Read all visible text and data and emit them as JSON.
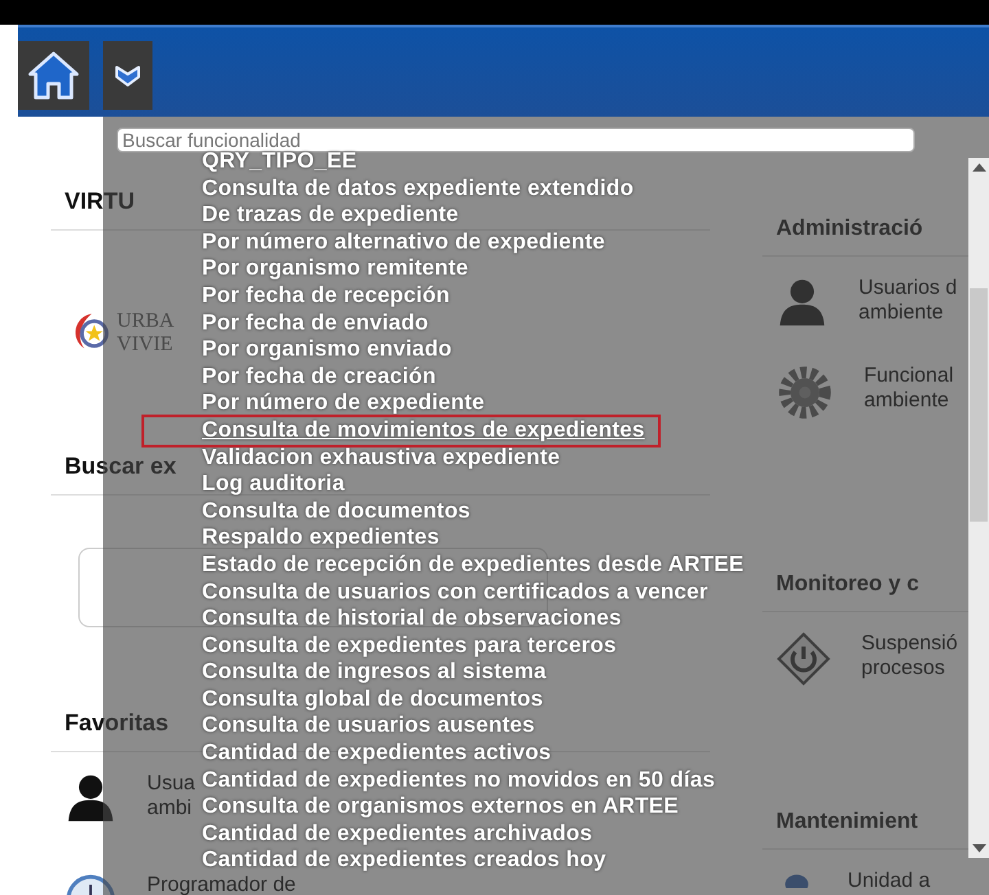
{
  "search": {
    "placeholder": "Buscar funcionalidad"
  },
  "menu_items": [
    {
      "label": "QRY_TIPO_EE",
      "selected": false
    },
    {
      "label": "Consulta de datos expediente extendido",
      "selected": false
    },
    {
      "label": "De trazas de expediente",
      "selected": false
    },
    {
      "label": "Por número alternativo de expediente",
      "selected": false
    },
    {
      "label": "Por organismo remitente",
      "selected": false
    },
    {
      "label": "Por fecha de recepción",
      "selected": false
    },
    {
      "label": "Por fecha de enviado",
      "selected": false
    },
    {
      "label": "Por organismo enviado",
      "selected": false
    },
    {
      "label": "Por fecha de creación",
      "selected": false
    },
    {
      "label": "Por número de expediente",
      "selected": false
    },
    {
      "label": "Consulta de movimientos de expedientes",
      "selected": true
    },
    {
      "label": "Validacion exhaustiva expediente",
      "selected": false
    },
    {
      "label": "Log auditoria",
      "selected": false
    },
    {
      "label": "Consulta de documentos",
      "selected": false
    },
    {
      "label": "Respaldo expedientes",
      "selected": false
    },
    {
      "label": "Estado de recepción de expedientes desde ARTEE",
      "selected": false
    },
    {
      "label": "Consulta de usuarios con certificados a vencer",
      "selected": false
    },
    {
      "label": "Consulta de historial de observaciones",
      "selected": false
    },
    {
      "label": "Consulta de expedientes para terceros",
      "selected": false
    },
    {
      "label": "Consulta de ingresos al sistema",
      "selected": false
    },
    {
      "label": "Consulta global de documentos",
      "selected": false
    },
    {
      "label": "Consulta de usuarios ausentes",
      "selected": false
    },
    {
      "label": "Cantidad de expedientes activos",
      "selected": false
    },
    {
      "label": "Cantidad de expedientes no movidos en 50 días",
      "selected": false
    },
    {
      "label": "Consulta de organismos externos en ARTEE",
      "selected": false
    },
    {
      "label": "Cantidad de expedientes archivados",
      "selected": false
    },
    {
      "label": "Cantidad de expedientes creados hoy",
      "selected": false
    }
  ],
  "left": {
    "title": "VIRTU",
    "logo_left": [
      "URBA",
      "VIVIE"
    ],
    "search_title": "Buscar ex",
    "favorites_title": "Favoritas",
    "favorites": [
      {
        "kind": "user",
        "lines": [
          "Usua",
          "ambi"
        ]
      },
      {
        "kind": "clock",
        "lines": [
          "Programador de"
        ]
      }
    ]
  },
  "right": {
    "sections": [
      {
        "title": "Administració",
        "items": [
          {
            "kind": "user",
            "lines": [
              "Usuarios d",
              "ambiente"
            ]
          },
          {
            "kind": "gear",
            "lines": [
              "Funcional",
              "ambiente"
            ]
          }
        ]
      },
      {
        "title": "Monitoreo y c",
        "items": [
          {
            "kind": "power",
            "lines": [
              "Suspensió",
              "procesos"
            ]
          }
        ]
      },
      {
        "title": "Mantenimient",
        "items": [
          {
            "kind": "unit",
            "lines": [
              "Unidad a"
            ]
          }
        ]
      }
    ]
  }
}
